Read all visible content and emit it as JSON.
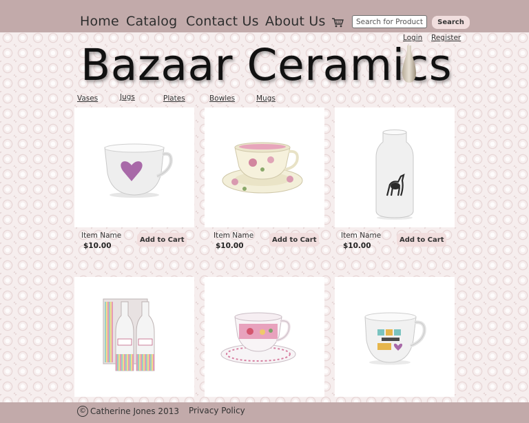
{
  "nav": {
    "items": [
      "Home",
      "Catalog",
      "Contact Us",
      "About Us"
    ],
    "cart_icon": "shopping-cart-icon",
    "search_placeholder": "Search for Products",
    "search_button": "Search"
  },
  "account": {
    "login": "Login",
    "register": "Register"
  },
  "brand": {
    "title": "Bazaar Ceramics",
    "title_icon": "vase-icon"
  },
  "categories": [
    "Vases",
    "Jugs",
    "Plates",
    "Bowles",
    "Mugs"
  ],
  "products": [
    {
      "name": "Item Name",
      "price": "$10.00",
      "button": "Add to Cart",
      "image": "heart-mug-image"
    },
    {
      "name": "Item Name",
      "price": "$10.00",
      "button": "Add to Cart",
      "image": "floral-teacup-image"
    },
    {
      "name": "Item Name",
      "price": "$10.00",
      "button": "Add to Cart",
      "image": "deer-vase-image"
    },
    {
      "image": "striped-bottles-image"
    },
    {
      "image": "pink-teacup-image"
    },
    {
      "image": "you-and-me-mug-image"
    }
  ],
  "footer": {
    "copyright_icon": "©",
    "copyright": "Catherine Jones 2013",
    "privacy": "Privacy Policy"
  },
  "colors": {
    "bar": "#c2aaaa",
    "button": "#f1dede",
    "card": "#ffffff"
  }
}
